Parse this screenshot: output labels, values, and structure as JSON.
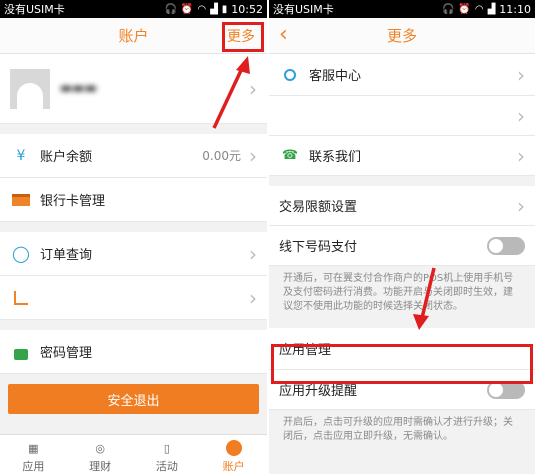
{
  "left": {
    "status": {
      "carrier": "没有USIM卡",
      "time": "10:52"
    },
    "nav": {
      "title": "账户",
      "more": "更多"
    },
    "rows": {
      "balance_label": "账户余额",
      "balance_value": "0.00元",
      "bankcard": "银行卡管理",
      "orders": "订单查询",
      "password": "密码管理"
    },
    "logout": "安全退出",
    "tabs": [
      {
        "label": "应用"
      },
      {
        "label": "理财"
      },
      {
        "label": "活动"
      },
      {
        "label": "账户"
      }
    ]
  },
  "right": {
    "status": {
      "carrier": "没有USIM卡",
      "time": "11:10"
    },
    "nav": {
      "title": "更多"
    },
    "rows": {
      "customer_service": "客服中心",
      "contact": "联系我们",
      "limit": "交易限额设置",
      "offline_pay": "线下号码支付",
      "app_manage": "应用管理",
      "upgrade_remind": "应用升级提醒"
    },
    "notes": {
      "offline": "开通后，可在翼支付合作商户的POS机上使用手机号及支付密码进行消费。功能开启与关闭即时生效，建议您不使用此功能的时候选择关闭状态。",
      "upgrade": "开启后，点击可升级的应用时需确认才进行升级；关闭后，点击应用立即升级，无需确认。"
    }
  },
  "colors": {
    "accent": "#f07d22",
    "highlight": "#e01e1e"
  }
}
